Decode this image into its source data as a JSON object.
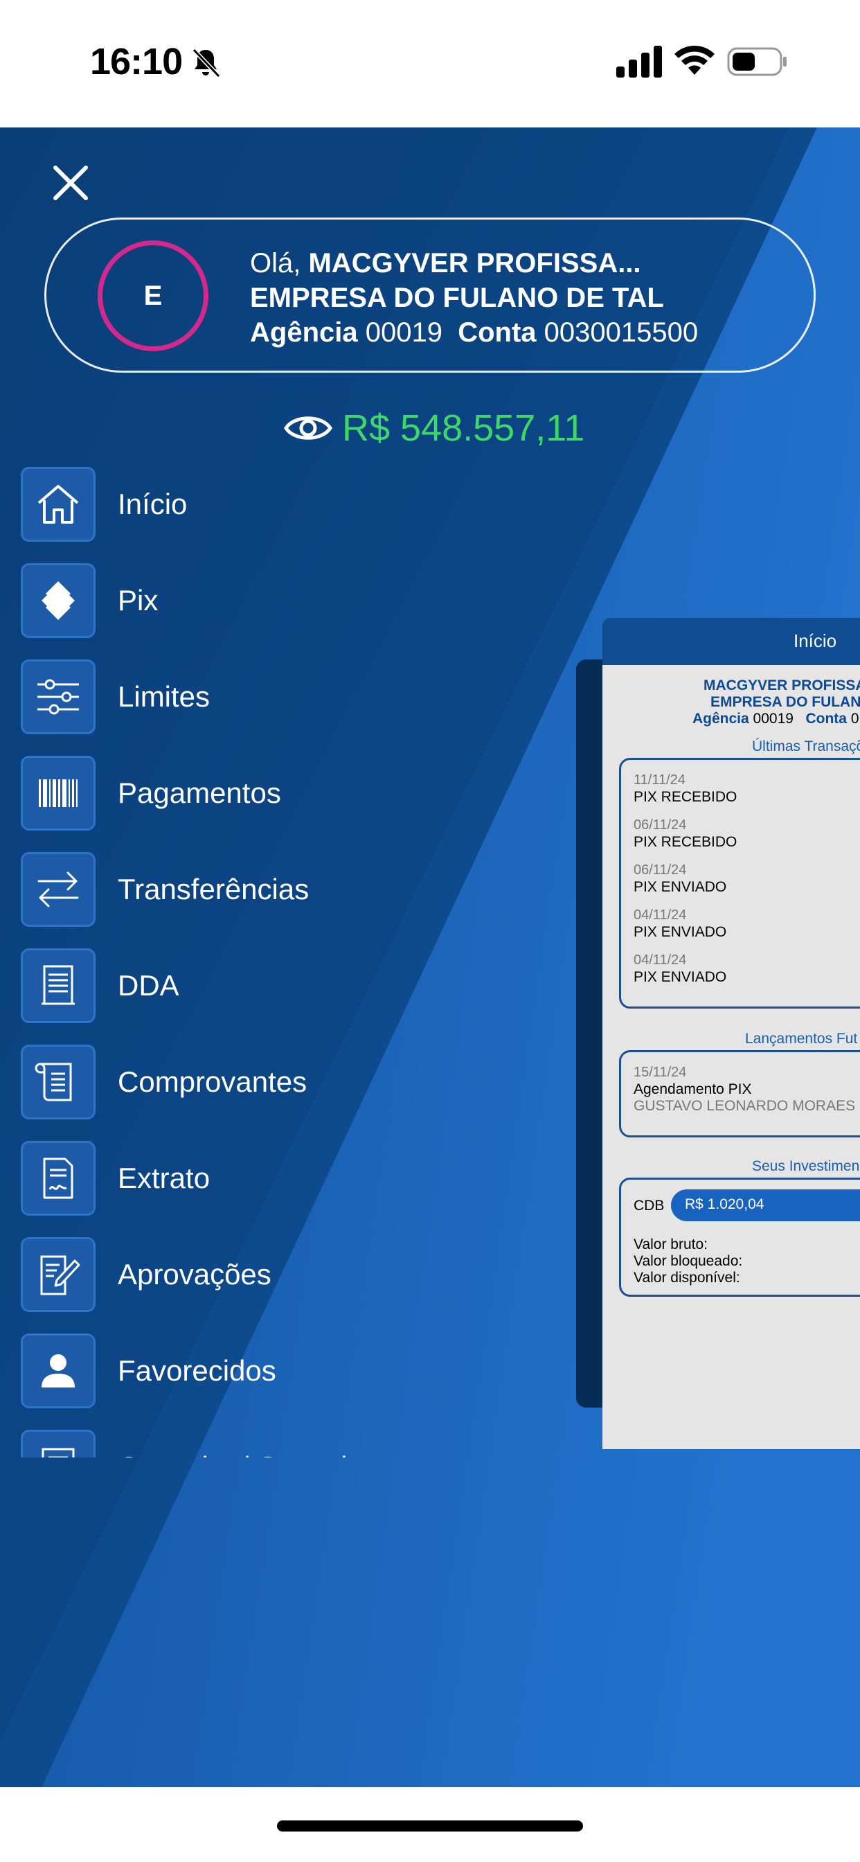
{
  "status_bar": {
    "time": "16:10"
  },
  "profile": {
    "avatar_initial": "E",
    "greeting": "Olá,",
    "user_name": "MACGYVER PROFISSA...",
    "company": "EMPRESA DO FULANO DE TAL",
    "agencia_label": "Agência",
    "agencia_value": "00019",
    "conta_label": "Conta",
    "conta_value": "0030015500"
  },
  "balance": {
    "value": "R$ 548.557,11",
    "color": "#3ed86a"
  },
  "menu": {
    "items": [
      {
        "label": "Início",
        "icon": "home-icon"
      },
      {
        "label": "Pix",
        "icon": "pix-icon"
      },
      {
        "label": "Limites",
        "icon": "sliders-icon"
      },
      {
        "label": "Pagamentos",
        "icon": "barcode-icon"
      },
      {
        "label": "Transferências",
        "icon": "transfer-arrows-icon"
      },
      {
        "label": "DDA",
        "icon": "document-list-icon"
      },
      {
        "label": "Comprovantes",
        "icon": "receipt-scroll-icon"
      },
      {
        "label": "Extrato",
        "icon": "statement-icon"
      },
      {
        "label": "Aprovações",
        "icon": "approval-pen-icon"
      },
      {
        "label": "Favorecidos",
        "icon": "person-icon"
      },
      {
        "label": "Consulta / Cancelamentos",
        "icon": "consult-icon"
      }
    ]
  },
  "preview": {
    "header_title": "Início",
    "user_name": "MACGYVER PROFISSA",
    "company": "EMPRESA DO FULAN",
    "agencia_label": "Agência",
    "agencia_value": "00019",
    "conta_label": "Conta",
    "conta_value": "0",
    "transactions_title": "Últimas Transaçõ",
    "transactions": [
      {
        "date": "11/11/24",
        "desc": "PIX RECEBIDO"
      },
      {
        "date": "06/11/24",
        "desc": "PIX RECEBIDO"
      },
      {
        "date": "06/11/24",
        "desc": "PIX ENVIADO"
      },
      {
        "date": "04/11/24",
        "desc": "PIX ENVIADO"
      },
      {
        "date": "04/11/24",
        "desc": "PIX ENVIADO"
      }
    ],
    "future_title": "Lançamentos Fut",
    "future": {
      "date": "15/11/24",
      "desc": "Agendamento PIX",
      "name": "GUSTAVO LEONARDO MORAES"
    },
    "invest_title": "Seus Investimen",
    "invest": {
      "label": "CDB",
      "value": "R$ 1.020,04",
      "bruto": "Valor bruto:",
      "bloqueado": "Valor bloqueado:",
      "disponivel": "Valor disponível:"
    }
  },
  "colors": {
    "background_dark": "#0a3e78",
    "background_light": "#1f6cc8",
    "avatar_ring": "#d4288c",
    "icon_box": "#1d5aa8"
  }
}
